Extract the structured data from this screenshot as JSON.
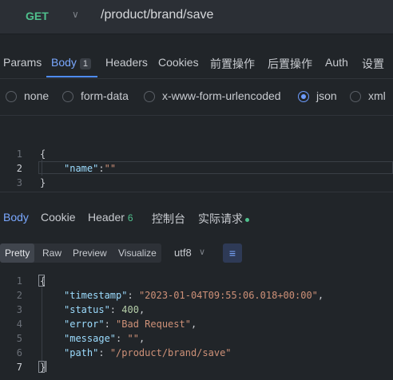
{
  "request": {
    "method": "GET",
    "url": "/product/brand/save"
  },
  "request_tabs": [
    {
      "label": "Params"
    },
    {
      "label": "Body",
      "count": "1"
    },
    {
      "label": "Headers"
    },
    {
      "label": "Cookies"
    },
    {
      "label": "前置操作"
    },
    {
      "label": "后置操作"
    },
    {
      "label": "Auth"
    },
    {
      "label": "设置"
    }
  ],
  "active_request_tab": "Body",
  "body_types": [
    "none",
    "form-data",
    "x-www-form-urlencoded",
    "json",
    "xml"
  ],
  "selected_body_type": "json",
  "request_editor": {
    "line_numbers": [
      "1",
      "2",
      "3"
    ],
    "lines": [
      "{",
      "    \"name\":\"\"",
      "}"
    ],
    "tokens": {
      "open": "{",
      "name_key": "\"name\"",
      "colon": ":",
      "name_value": "\"\"",
      "close": "}"
    }
  },
  "response_tabs": [
    {
      "label": "Body"
    },
    {
      "label": "Cookie"
    },
    {
      "label": "Header",
      "count": "6"
    },
    {
      "label": "控制台"
    },
    {
      "label": "实际请求"
    }
  ],
  "active_response_tab": "Body",
  "format_options": [
    "Pretty",
    "Raw",
    "Preview",
    "Visualize"
  ],
  "selected_format": "Pretty",
  "encoding": "utf8",
  "response_editor": {
    "line_numbers": [
      "1",
      "2",
      "3",
      "4",
      "5",
      "6",
      "7"
    ],
    "fields": {
      "timestamp_key": "\"timestamp\"",
      "timestamp_value": "\"2023-01-04T09:55:06.018+00:00\"",
      "status_key": "\"status\"",
      "status_value": "400",
      "error_key": "\"error\"",
      "error_value": "\"Bad Request\"",
      "message_key": "\"message\"",
      "message_value": "\"\"",
      "path_key": "\"path\"",
      "path_value": "\"/product/brand/save\""
    },
    "open": "{",
    "close": "}"
  },
  "colors": {
    "background": "#212529",
    "method_green": "#4fc08d",
    "active_blue": "#7aa8ff",
    "json_key": "#9cdcfe",
    "json_string": "#ce9178",
    "json_number": "#b5cea8"
  }
}
